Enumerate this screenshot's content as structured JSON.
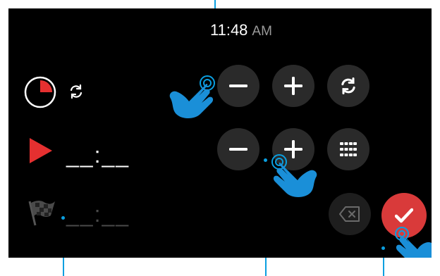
{
  "clock": {
    "time": "11:48",
    "ampm": "AM"
  },
  "rows": {
    "timer": {
      "icon": "timer-pie-icon",
      "mode_icon": "repeat-icon"
    },
    "start": {
      "icon": "play-triangle-icon",
      "value": "__:__"
    },
    "finish": {
      "icon": "checkered-flag-icon",
      "value": "__:__"
    }
  },
  "buttons": {
    "minus_1": "minus-icon",
    "plus_1": "plus-icon",
    "repeat": "repeat-icon",
    "minus_2": "minus-icon",
    "plus_2": "plus-icon",
    "keypad": "keypad-grid-icon",
    "backspace": "backspace-icon",
    "confirm": "checkmark-icon"
  },
  "colors": {
    "accent_red": "#d93a3a",
    "button_bg": "#2a2a2a",
    "callout_blue": "#0a9fe0",
    "hand_blue": "#1a8fd8"
  }
}
